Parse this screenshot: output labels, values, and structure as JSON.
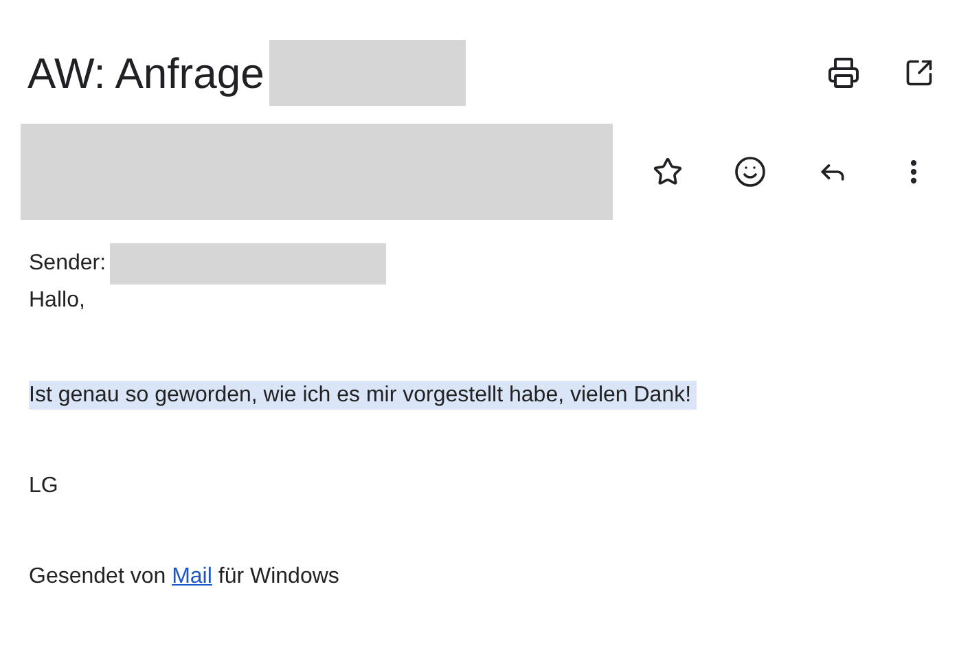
{
  "title": "AW: Anfrage",
  "sender_label": "Sender:",
  "body": [
    {
      "text": "Hallo,",
      "highlighted": false
    },
    {
      "text": "Ist genau so geworden, wie ich es mir vorgestellt habe, vielen Dank!",
      "highlighted": true
    },
    {
      "text": "LG",
      "highlighted": false
    }
  ],
  "signature": {
    "before": "Gesendet von",
    "link": "Mail",
    "after": "für Windows"
  }
}
